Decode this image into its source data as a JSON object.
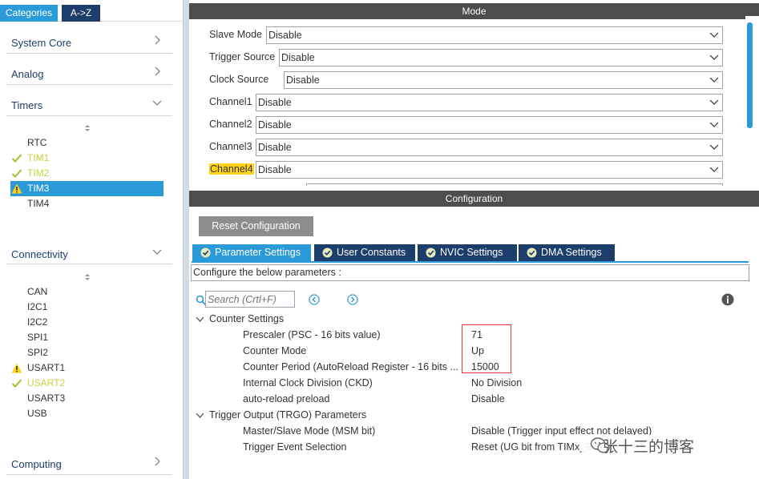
{
  "left": {
    "tabs": [
      {
        "label": "Categories",
        "active": true
      },
      {
        "label": "A->Z",
        "active": false
      }
    ],
    "categories": [
      {
        "label": "System Core",
        "expanded": false
      },
      {
        "label": "Analog",
        "expanded": false
      },
      {
        "label": "Timers",
        "expanded": true
      },
      {
        "label": "Connectivity",
        "expanded": true
      },
      {
        "label": "Computing",
        "expanded": false
      }
    ],
    "timers": [
      {
        "name": "RTC",
        "status": "none"
      },
      {
        "name": "TIM1",
        "status": "ok"
      },
      {
        "name": "TIM2",
        "status": "ok"
      },
      {
        "name": "TIM3",
        "status": "warning",
        "selected": true
      },
      {
        "name": "TIM4",
        "status": "none"
      }
    ],
    "connectivity": [
      {
        "name": "CAN",
        "status": "none"
      },
      {
        "name": "I2C1",
        "status": "none"
      },
      {
        "name": "I2C2",
        "status": "none"
      },
      {
        "name": "SPI1",
        "status": "none"
      },
      {
        "name": "SPI2",
        "status": "none"
      },
      {
        "name": "USART1",
        "status": "warning"
      },
      {
        "name": "USART2",
        "status": "ok"
      },
      {
        "name": "USART3",
        "status": "none"
      },
      {
        "name": "USB",
        "status": "none"
      }
    ]
  },
  "mode": {
    "title": "Mode",
    "rows": [
      {
        "label": "Slave Mode",
        "value": "Disable"
      },
      {
        "label": "Trigger Source",
        "value": "Disable"
      },
      {
        "label": "Clock Source",
        "value": "Disable"
      },
      {
        "label": "Channel1",
        "value": "Disable"
      },
      {
        "label": "Channel2",
        "value": "Disable"
      },
      {
        "label": "Channel3",
        "value": "Disable"
      },
      {
        "label": "Channel4",
        "value": "Disable",
        "highlight": true
      }
    ]
  },
  "config": {
    "title": "Configuration",
    "reset_label": "Reset Configuration",
    "tabs": [
      {
        "label": "Parameter Settings",
        "active": true
      },
      {
        "label": "User Constants",
        "active": false
      },
      {
        "label": "NVIC Settings",
        "active": false
      },
      {
        "label": "DMA Settings",
        "active": false
      }
    ],
    "description": "Configure the below parameters :",
    "search_placeholder": "Search (Crtl+F)",
    "groups": [
      {
        "title": "Counter Settings",
        "params": [
          {
            "name": "Prescaler (PSC - 16 bits value)",
            "value": "71"
          },
          {
            "name": "Counter Mode",
            "value": "Up"
          },
          {
            "name": "Counter Period (AutoReload Register - 16 bits ...",
            "value": "15000"
          },
          {
            "name": "Internal Clock Division (CKD)",
            "value": "No Division"
          },
          {
            "name": "auto-reload preload",
            "value": "Disable"
          }
        ]
      },
      {
        "title": "Trigger Output (TRGO) Parameters",
        "params": [
          {
            "name": "Master/Slave Mode (MSM bit)",
            "value": "Disable (Trigger input effect not delayed)"
          },
          {
            "name": "Trigger Event Selection",
            "value": "Reset (UG bit from TIMx_EGR)"
          }
        ]
      }
    ]
  },
  "watermark": "张十三的博客",
  "colors": {
    "navy": "#1c3e6b",
    "accent_blue": "#2a9ad8",
    "ok_green": "#c7d23c",
    "warning_yellow": "#ffd31a",
    "highlight_red": "#e03a3a",
    "bar_gray": "#4d4d4d"
  }
}
